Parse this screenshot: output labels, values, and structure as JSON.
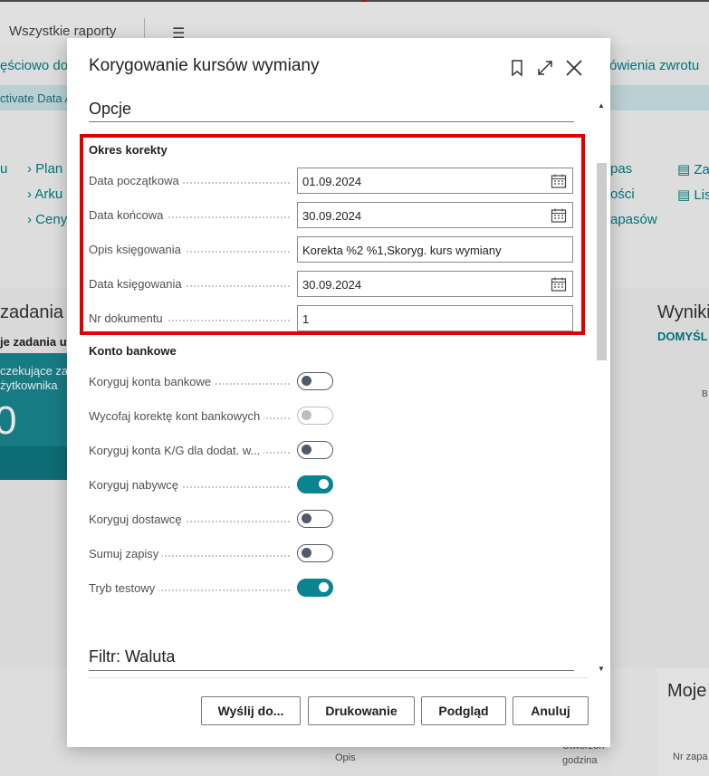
{
  "background": {
    "header_title": "Wszystkie raporty",
    "top_links": [
      "ęściowo do",
      "ówienia zwrotu"
    ],
    "banner_text": "ctivate Data A",
    "nav_left": [
      "Plan",
      "Arku",
      "Ceny"
    ],
    "nav_right": [
      "pas",
      "ości",
      "apasów"
    ],
    "nav_far_right": [
      "Za",
      "Lis"
    ],
    "card_left_title": "zadania uż",
    "card_left_sub": "je zadania u",
    "tile_text_1": "czekujące za",
    "tile_text_2": "żytkownika",
    "tile_count": "0",
    "card_right_title": "Wyniki",
    "card_right_sub": "DOMYŚL",
    "right_small": "B",
    "bottom_right_title": "Moje",
    "bottom_right_col": "Nr zapa",
    "bottom_col_opis": "Opis",
    "bottom_col_godzina_1": "Utworzon",
    "bottom_col_godzina_2": "godzina"
  },
  "dialog": {
    "title": "Korygowanie kursów wymiany",
    "icons": [
      "bookmark-icon",
      "expand-icon",
      "close-icon"
    ],
    "options_title": "Opcje",
    "period_group": "Okres korekty",
    "period_fields": [
      {
        "label": "Data początkowa",
        "value": "01.09.2024",
        "calendar": true
      },
      {
        "label": "Data końcowa",
        "value": "30.09.2024",
        "calendar": true
      },
      {
        "label": "Opis księgowania",
        "value": "Korekta %2 %1,Skoryg. kurs wymiany",
        "calendar": false
      },
      {
        "label": "Data księgowania",
        "value": "30.09.2024",
        "calendar": true
      },
      {
        "label": "Nr dokumentu",
        "value": "1",
        "calendar": false
      }
    ],
    "bank_group": "Konto bankowe",
    "toggles": [
      {
        "label": "Koryguj konta bankowe",
        "on": false,
        "disabled": false
      },
      {
        "label": "Wycofaj korektę kont bankowych",
        "on": false,
        "disabled": true
      },
      {
        "label": "Koryguj konta K/G dla dodat. w...",
        "on": false,
        "disabled": false
      },
      {
        "label": "Koryguj nabywcę",
        "on": true,
        "disabled": false
      },
      {
        "label": "Koryguj dostawcę",
        "on": false,
        "disabled": false
      },
      {
        "label": "Sumuj zapisy",
        "on": false,
        "disabled": false
      },
      {
        "label": "Tryb testowy",
        "on": true,
        "disabled": false
      }
    ],
    "filter_title": "Filtr: Waluta",
    "buttons": {
      "send": "Wyślij do...",
      "print": "Drukowanie",
      "preview": "Podgląd",
      "cancel": "Anuluj"
    },
    "colors": {
      "accent": "#098490",
      "highlight": "#e00000"
    }
  }
}
